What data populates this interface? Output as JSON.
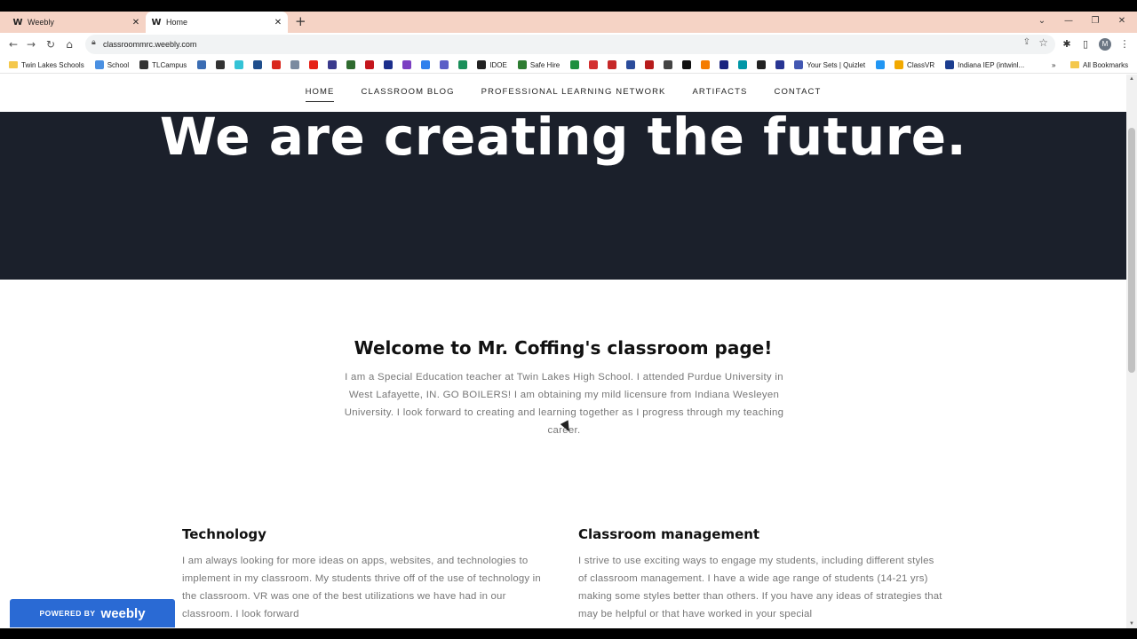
{
  "browser": {
    "tabs": [
      {
        "title": "Weebly",
        "favicon": "W",
        "active": false
      },
      {
        "title": "Home",
        "favicon": "W",
        "active": true
      }
    ],
    "new_tab_glyph": "+",
    "close_glyph": "✕",
    "url": "classroommrc.weebly.com",
    "profile_initial": "M",
    "bookmarks": [
      {
        "label": "Twin Lakes Schools",
        "color": "#f4c84c",
        "folder": true
      },
      {
        "label": "School",
        "color": "#4a90e2"
      },
      {
        "label": "TLCampus",
        "color": "#333333"
      },
      {
        "label": "",
        "color": "#3b6db3"
      },
      {
        "label": "",
        "color": "#333333"
      },
      {
        "label": "",
        "color": "#34c3d6"
      },
      {
        "label": "",
        "color": "#1f4e8c"
      },
      {
        "label": "",
        "color": "#d9261c"
      },
      {
        "label": "",
        "color": "#7a8aa0"
      },
      {
        "label": "",
        "color": "#e62117"
      },
      {
        "label": "",
        "color": "#3a3a8c"
      },
      {
        "label": "",
        "color": "#2f6b2f"
      },
      {
        "label": "",
        "color": "#c4161c"
      },
      {
        "label": "",
        "color": "#1c2f8c"
      },
      {
        "label": "",
        "color": "#7b3fc2"
      },
      {
        "label": "",
        "color": "#2f80ed"
      },
      {
        "label": "",
        "color": "#5b5fc7"
      },
      {
        "label": "",
        "color": "#1a8f5a"
      },
      {
        "label": "IDOE",
        "color": "#222222"
      },
      {
        "label": "Safe Hire",
        "color": "#2e7d32"
      },
      {
        "label": "",
        "color": "#1e8f3e"
      },
      {
        "label": "",
        "color": "#d32f2f"
      },
      {
        "label": "",
        "color": "#c62828"
      },
      {
        "label": "",
        "color": "#2b4c9b"
      },
      {
        "label": "",
        "color": "#b71c1c"
      },
      {
        "label": "",
        "color": "#444444"
      },
      {
        "label": "",
        "color": "#111111"
      },
      {
        "label": "",
        "color": "#f57c00"
      },
      {
        "label": "",
        "color": "#1a237e"
      },
      {
        "label": "",
        "color": "#0097a7"
      },
      {
        "label": "",
        "color": "#222222"
      },
      {
        "label": "",
        "color": "#283593"
      },
      {
        "label": "Your Sets | Quizlet",
        "color": "#4257b2"
      },
      {
        "label": "",
        "color": "#2196f3"
      },
      {
        "label": "ClassVR",
        "color": "#f2a900"
      },
      {
        "label": "Indiana IEP (intwinl...",
        "color": "#1b3d8f"
      }
    ],
    "more_bookmarks_glyph": "»",
    "all_bookmarks": "All Bookmarks"
  },
  "site": {
    "nav": [
      "HOME",
      "CLASSROOM BLOG",
      "PROFESSIONAL LEARNING NETWORK",
      "ARTIFACTS",
      "CONTACT"
    ],
    "active_nav_index": 0,
    "hero_text": "We are creating the future.",
    "welcome_title": "Welcome to Mr. Coffing's classroom page!",
    "bio": "I am a Special Education teacher at Twin Lakes High School. I attended Purdue University in West Lafayette, IN. GO BOILERS! I am obtaining my mild licensure from Indiana Wesleyen University. I look forward to creating and learning together as I progress through my teaching career.",
    "technology": {
      "title": "Technology",
      "body": "I am always looking for more ideas on apps, websites, and technologies to implement in my classroom. My students thrive off of the use of technology in the classroom. VR was one of the best utilizations we have had in our classroom. I look forward"
    },
    "classroom_management": {
      "title": "Classroom management",
      "body": "I strive to use exciting ways to engage my students, including different styles of classroom management. I have a wide age range of students (14-21 yrs) making some styles better than others. If you have any ideas of strategies that may be helpful or that have worked in your special"
    },
    "badge": {
      "powered_by": "POWERED BY",
      "brand": "weebly"
    }
  }
}
